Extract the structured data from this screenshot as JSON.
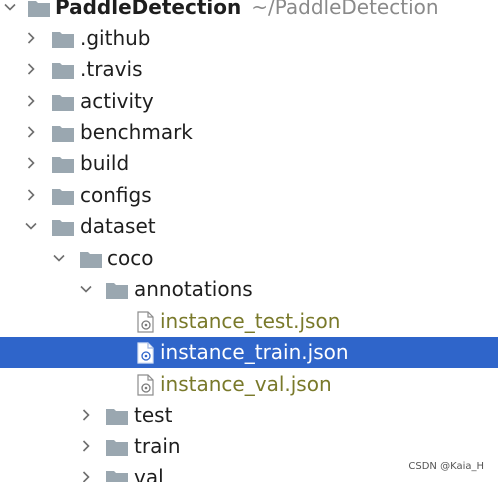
{
  "project_tree": {
    "root": {
      "name": "PaddleDetection",
      "path": "~/PaddleDetection"
    },
    "items": [
      {
        "label": ".github",
        "type": "folder",
        "expanded": false
      },
      {
        "label": ".travis",
        "type": "folder",
        "expanded": false
      },
      {
        "label": "activity",
        "type": "folder",
        "expanded": false
      },
      {
        "label": "benchmark",
        "type": "folder",
        "expanded": false
      },
      {
        "label": "build",
        "type": "folder",
        "expanded": false
      },
      {
        "label": "configs",
        "type": "folder",
        "expanded": false
      },
      {
        "label": "dataset",
        "type": "folder",
        "expanded": true
      },
      {
        "label": "coco",
        "type": "folder",
        "expanded": true
      },
      {
        "label": "annotations",
        "type": "folder",
        "expanded": true
      },
      {
        "label": "instance_test.json",
        "type": "json-file"
      },
      {
        "label": "instance_train.json",
        "type": "json-file",
        "selected": true
      },
      {
        "label": "instance_val.json",
        "type": "json-file"
      },
      {
        "label": "test",
        "type": "folder",
        "expanded": false
      },
      {
        "label": "train",
        "type": "folder",
        "expanded": false
      },
      {
        "label": "val",
        "type": "folder",
        "expanded": false
      }
    ]
  },
  "watermark": "CSDN @Kaia_H",
  "colors": {
    "selection_background": "#2f65ca",
    "json_file_text": "#79792a",
    "folder_icon": "#9aa7b0",
    "root_path_text": "#8a8a8a"
  }
}
